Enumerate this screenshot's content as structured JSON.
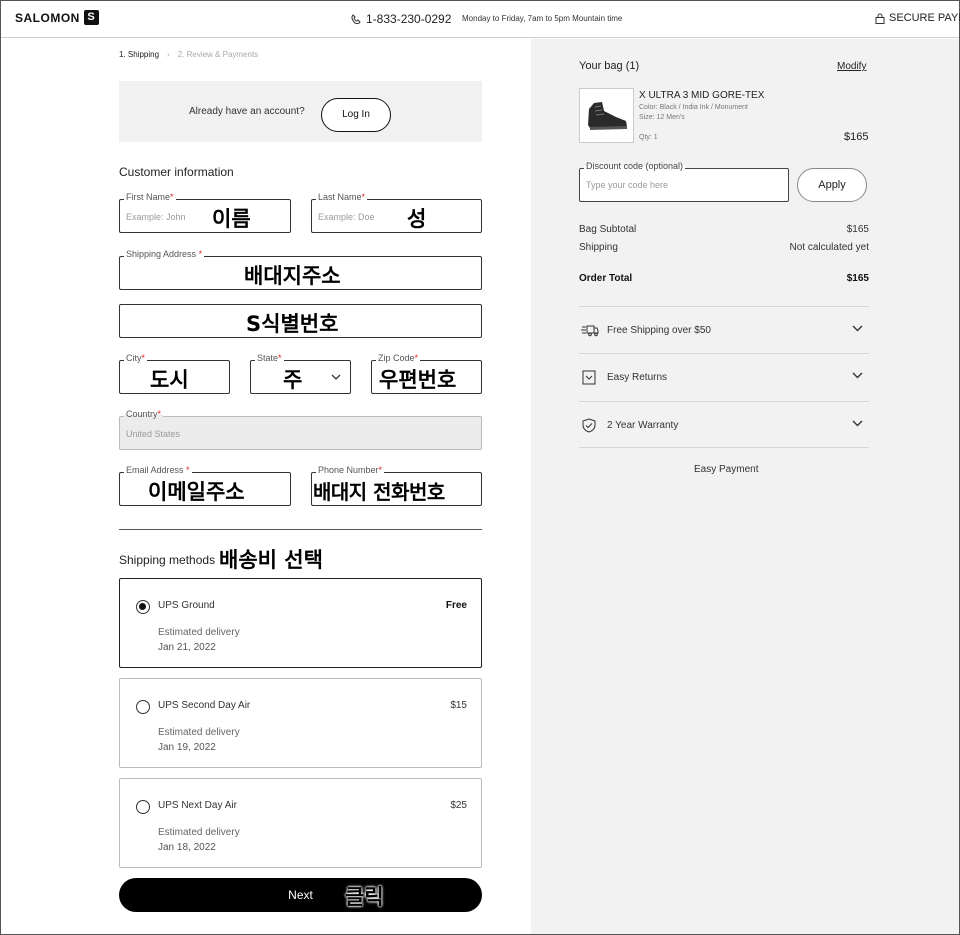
{
  "header": {
    "logo": "SALOMON",
    "logo_mark": "S",
    "phone": "1-833-230-0292",
    "hours": "Monday to Friday, 7am to 5pm Mountain time",
    "secure": "SECURE PAYMENT"
  },
  "breadcrumb": {
    "step1": "1. Shipping",
    "sep": "›",
    "step2": "2. Review & Payments"
  },
  "account": {
    "prompt": "Already have an account?",
    "login": "Log In"
  },
  "customer": {
    "title": "Customer information",
    "first_name": {
      "label": "First Name",
      "placeholder": "Example: John",
      "annotation": "이름"
    },
    "last_name": {
      "label": "Last Name",
      "placeholder": "Example: Doe",
      "annotation": "성"
    },
    "shipping_address": {
      "label": "Shipping Address",
      "annotation": "배대지주소"
    },
    "address2": {
      "annotation": "S식별번호"
    },
    "city": {
      "label": "City",
      "annotation": "도시"
    },
    "state": {
      "label": "State",
      "annotation": "주"
    },
    "zip": {
      "label": "Zip Code",
      "annotation": "우편번호"
    },
    "country": {
      "label": "Country",
      "value": "United States"
    },
    "email": {
      "label": "Email Address",
      "annotation": "이메일주소"
    },
    "phone": {
      "label": "Phone Number",
      "annotation": "배대지 전화번호"
    },
    "required_mark": "*"
  },
  "shipping": {
    "title": "Shipping methods",
    "annotation": "배송비 선택",
    "methods": [
      {
        "name": "UPS Ground",
        "price": "Free",
        "est_label": "Estimated delivery",
        "date": "Jan 21, 2022",
        "selected": true
      },
      {
        "name": "UPS Second Day Air",
        "price": "$15",
        "est_label": "Estimated delivery",
        "date": "Jan 19, 2022",
        "selected": false
      },
      {
        "name": "UPS Next Day Air",
        "price": "$25",
        "est_label": "Estimated delivery",
        "date": "Jan 18, 2022",
        "selected": false
      }
    ],
    "next": "Next",
    "next_annotation": "클릭"
  },
  "bag": {
    "title": "Your bag (1)",
    "modify": "Modify",
    "product": {
      "name": "X ULTRA 3 MID GORE-TEX",
      "color": "Color:  Black / India Ink / Monument",
      "size": "Size:  12 Men's",
      "qty": "Qty: 1",
      "price": "$165"
    },
    "discount": {
      "label": "Discount code (optional)",
      "placeholder": "Type your code here",
      "apply": "Apply"
    },
    "summary": {
      "subtotal_label": "Bag Subtotal",
      "subtotal": "$165",
      "shipping_label": "Shipping",
      "shipping": "Not calculated yet",
      "total_label": "Order Total",
      "total": "$165"
    },
    "perks": [
      "Free Shipping over $50",
      "Easy Returns",
      "2 Year Warranty"
    ],
    "easy_payment": "Easy Payment"
  }
}
